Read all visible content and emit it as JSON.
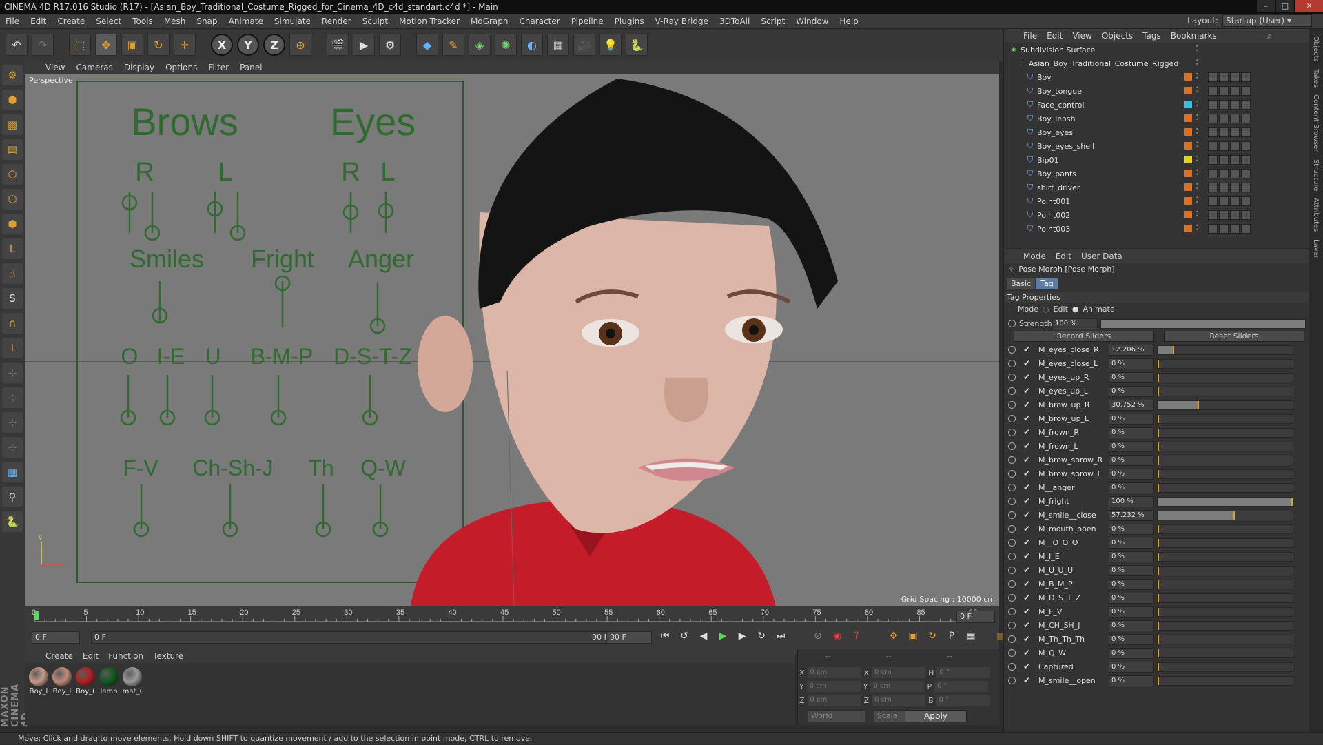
{
  "window": {
    "title": "CINEMA 4D R17.016 Studio (R17) - [Asian_Boy_Traditional_Costume_Rigged_for_Cinema_4D_c4d_standart.c4d *] - Main"
  },
  "menu": [
    "File",
    "Edit",
    "Create",
    "Select",
    "Tools",
    "Mesh",
    "Snap",
    "Animate",
    "Simulate",
    "Render",
    "Sculpt",
    "Motion Tracker",
    "MoGraph",
    "Character",
    "Pipeline",
    "Plugins",
    "V-Ray Bridge",
    "3DToAll",
    "Script",
    "Window",
    "Help"
  ],
  "layout": {
    "label": "Layout:",
    "value": "Startup (User)"
  },
  "viewport": {
    "menu": [
      "View",
      "Cameras",
      "Display",
      "Options",
      "Filter",
      "Panel"
    ],
    "label": "Perspective",
    "grid_spacing": "Grid Spacing : 10000 cm",
    "face_control": {
      "headers": [
        "Brows",
        "Eyes"
      ],
      "brow_rl": [
        "R",
        "L"
      ],
      "eye_rl": [
        "R",
        "L"
      ],
      "row2": [
        "Smiles",
        "Fright",
        "Anger"
      ],
      "row3": [
        "O",
        "I-E",
        "U",
        "B-M-P",
        "D-S-T-Z"
      ],
      "row4": [
        "F-V",
        "Ch-Sh-J",
        "Th",
        "Q-W"
      ]
    }
  },
  "timeline": {
    "ticks": [
      "0",
      "5",
      "10",
      "15",
      "20",
      "25",
      "30",
      "35",
      "40",
      "45",
      "50",
      "55",
      "60",
      "65",
      "70",
      "75",
      "80",
      "85",
      "90"
    ],
    "current_frame": "0 F",
    "start_field": "0 F",
    "range_start": "0 F",
    "range_end": "90 F",
    "end_field": "90 F"
  },
  "materials": {
    "menu": [
      "Create",
      "Edit",
      "Function",
      "Texture"
    ],
    "items": [
      {
        "name": "Boy_l",
        "color": "#c89a88"
      },
      {
        "name": "Boy_l",
        "color": "#c08a7a"
      },
      {
        "name": "Boy_(",
        "color": "#b02020"
      },
      {
        "name": "lamb",
        "color": "#0f5a1e"
      },
      {
        "name": "mat_(",
        "color": "#9a9a9a"
      }
    ]
  },
  "coords": {
    "header": [
      "--",
      "--",
      "--"
    ],
    "rows": [
      {
        "a": "X",
        "av": "0 cm",
        "b": "X",
        "bv": "0 cm",
        "c": "H",
        "cv": "0 °"
      },
      {
        "a": "Y",
        "av": "0 cm",
        "b": "Y",
        "bv": "0 cm",
        "c": "P",
        "cv": "0 °"
      },
      {
        "a": "Z",
        "av": "0 cm",
        "b": "Z",
        "bv": "0 cm",
        "c": "B",
        "cv": "0 °"
      }
    ],
    "world": "World",
    "scale": "Scale",
    "apply": "Apply"
  },
  "status": "Move: Click and drag to move elements. Hold down SHIFT to quantize movement / add to the selection in point mode, CTRL to remove.",
  "brand": "MAXON CINEMA 4D",
  "objects": {
    "menu": [
      "File",
      "Edit",
      "View",
      "Objects",
      "Tags",
      "Bookmarks"
    ],
    "items": [
      {
        "name": "Subdivision Surface",
        "indent": 0,
        "swatch": ""
      },
      {
        "name": "Asian_Boy_Traditional_Costume_Rigged",
        "indent": 1,
        "swatch": ""
      },
      {
        "name": "Boy",
        "indent": 2,
        "swatch": "#e07020"
      },
      {
        "name": "Boy_tongue",
        "indent": 2,
        "swatch": "#e07020"
      },
      {
        "name": "Face_control",
        "indent": 2,
        "swatch": "#30c0e0"
      },
      {
        "name": "Boy_leash",
        "indent": 2,
        "swatch": "#e07020"
      },
      {
        "name": "Boy_eyes",
        "indent": 2,
        "swatch": "#e07020"
      },
      {
        "name": "Boy_eyes_shell",
        "indent": 2,
        "swatch": "#e07020"
      },
      {
        "name": "Bip01",
        "indent": 2,
        "swatch": "#e0d020"
      },
      {
        "name": "Boy_pants",
        "indent": 2,
        "swatch": "#e07020"
      },
      {
        "name": "shirt_driver",
        "indent": 2,
        "swatch": "#e07020"
      },
      {
        "name": "Point001",
        "indent": 2,
        "swatch": "#e07020"
      },
      {
        "name": "Point002",
        "indent": 2,
        "swatch": "#e07020"
      },
      {
        "name": "Point003",
        "indent": 2,
        "swatch": "#e07020"
      }
    ]
  },
  "attributes": {
    "menu": [
      "Mode",
      "Edit",
      "User Data"
    ],
    "title": "Pose Morph [Pose Morph]",
    "tabs": [
      "Basic",
      "Tag"
    ],
    "section": "Tag Properties",
    "mode_label": "Mode",
    "mode_edit": "Edit",
    "mode_animate": "Animate",
    "strength_label": "Strength",
    "strength_value": "100 %",
    "record_sliders": "Record Sliders",
    "reset_sliders": "Reset Sliders",
    "sliders": [
      {
        "name": "M_eyes_close_R",
        "value": "12.206 %",
        "pct": 12.206
      },
      {
        "name": "M_eyes_close_L",
        "value": "0 %",
        "pct": 0
      },
      {
        "name": "M_eyes_up_R",
        "value": "0 %",
        "pct": 0
      },
      {
        "name": "M_eyes_up_L",
        "value": "0 %",
        "pct": 0
      },
      {
        "name": "M_brow_up_R",
        "value": "30.752 %",
        "pct": 30.752
      },
      {
        "name": "M_brow_up_L",
        "value": "0 %",
        "pct": 0
      },
      {
        "name": "M_frown_R",
        "value": "0 %",
        "pct": 0
      },
      {
        "name": "M_frown_L",
        "value": "0 %",
        "pct": 0
      },
      {
        "name": "M_brow_sorow_R",
        "value": "0 %",
        "pct": 0
      },
      {
        "name": "M_brow_sorow_L",
        "value": "0 %",
        "pct": 0
      },
      {
        "name": "M__anger",
        "value": "0 %",
        "pct": 0
      },
      {
        "name": "M_fright",
        "value": "100 %",
        "pct": 100
      },
      {
        "name": "M_smile__close",
        "value": "57.232 %",
        "pct": 57.232
      },
      {
        "name": "M_mouth_open",
        "value": "0 %",
        "pct": 0
      },
      {
        "name": "M__O_O_O",
        "value": "0 %",
        "pct": 0
      },
      {
        "name": "M_I_E",
        "value": "0 %",
        "pct": 0
      },
      {
        "name": "M_U_U_U",
        "value": "0 %",
        "pct": 0
      },
      {
        "name": "M_B_M_P",
        "value": "0 %",
        "pct": 0
      },
      {
        "name": "M_D_S_T_Z",
        "value": "0 %",
        "pct": 0
      },
      {
        "name": "M_F_V",
        "value": "0 %",
        "pct": 0
      },
      {
        "name": "M_CH_SH_J",
        "value": "0 %",
        "pct": 0
      },
      {
        "name": "M_Th_Th_Th",
        "value": "0 %",
        "pct": 0
      },
      {
        "name": "M_Q_W",
        "value": "0 %",
        "pct": 0
      },
      {
        "name": "Captured",
        "value": "0 %",
        "pct": 0
      },
      {
        "name": "M_smile__open",
        "value": "0 %",
        "pct": 0
      }
    ]
  },
  "sidetabs": [
    "Objects",
    "Takes",
    "Content Browser",
    "Structure",
    "Attributes",
    "Layer"
  ]
}
